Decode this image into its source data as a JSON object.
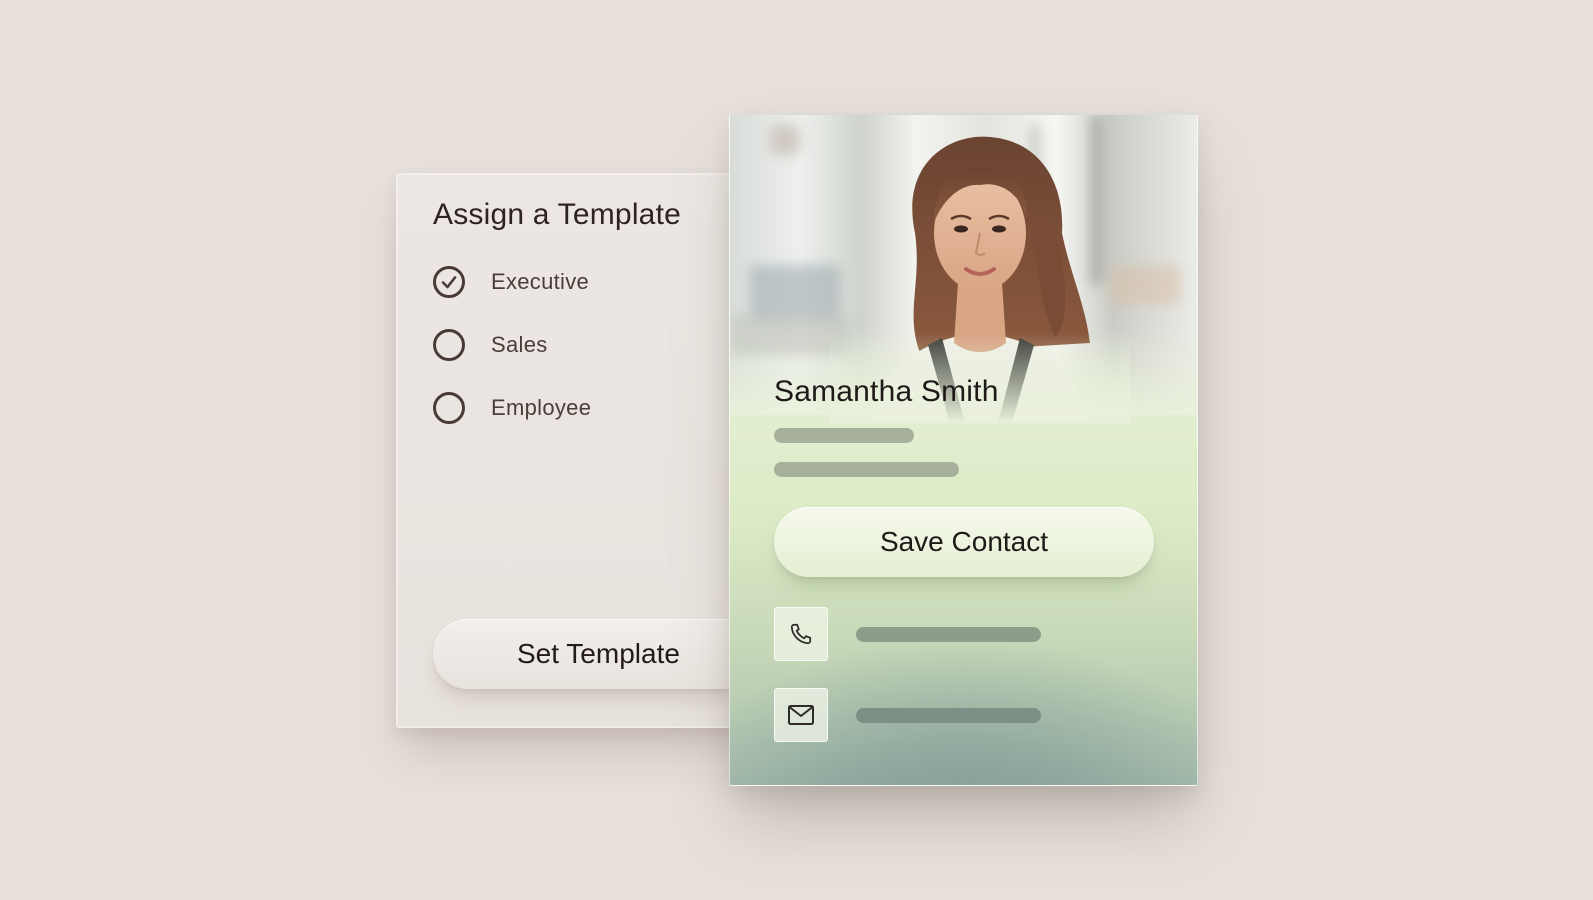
{
  "template_panel": {
    "title": "Assign a Template",
    "options": [
      {
        "label": "Executive",
        "selected": true
      },
      {
        "label": "Sales",
        "selected": false
      },
      {
        "label": "Employee",
        "selected": false
      }
    ],
    "set_button_label": "Set Template"
  },
  "contact_card": {
    "name": "Samantha Smith",
    "save_button_label": "Save Contact",
    "rows": [
      {
        "icon": "phone-icon"
      },
      {
        "icon": "mail-icon"
      }
    ]
  },
  "colors": {
    "background": "#e6dfda",
    "panel": "#ece7e3",
    "text_dark": "#221b19",
    "radio_stroke": "#4a3a37",
    "card_green": "#dcebc6",
    "card_teal": "#7f9995",
    "placeholder": "#a6b09a"
  }
}
